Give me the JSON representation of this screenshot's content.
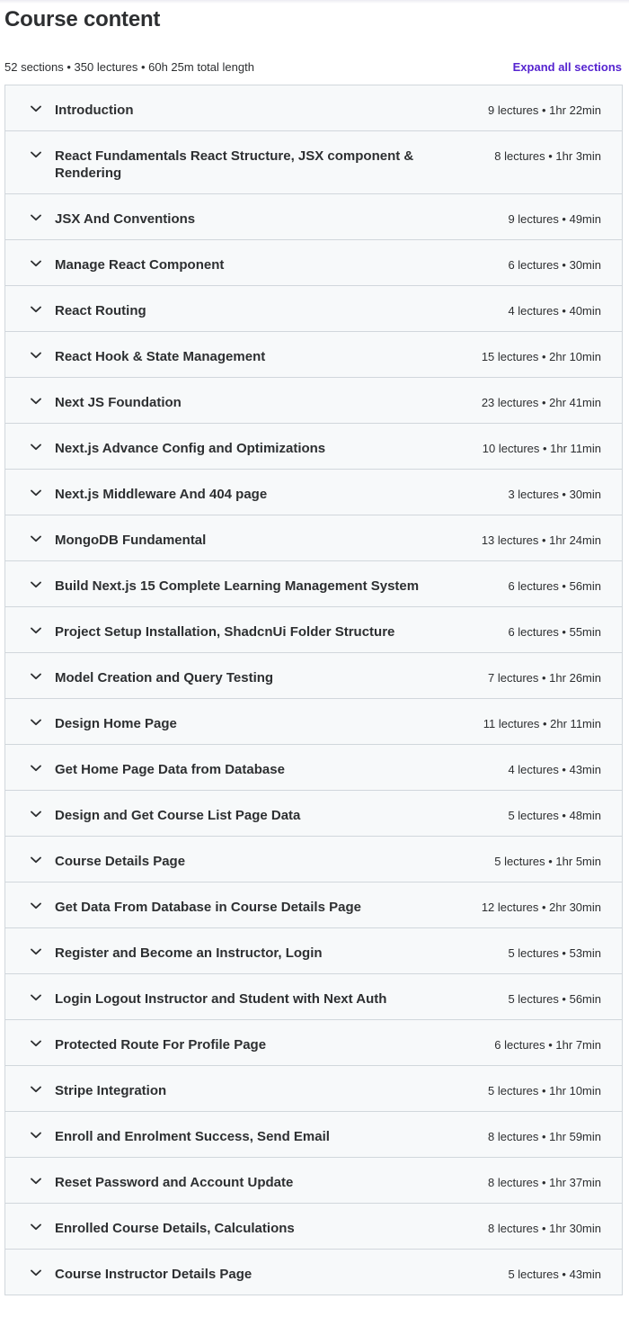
{
  "header": {
    "title": "Course content",
    "summary": "52 sections • 350 lectures • 60h 25m total length",
    "expand_all_label": "Expand all sections"
  },
  "colors": {
    "accent": "#5624d0",
    "section_bg": "#f7f9fa",
    "border": "#d1d7dc",
    "text": "#2d2f31"
  },
  "sections": [
    {
      "title": "Introduction",
      "meta": "9 lectures • 1hr 22min"
    },
    {
      "title": "React Fundamentals React Structure, JSX component & Rendering",
      "meta": "8 lectures • 1hr 3min"
    },
    {
      "title": "JSX And Conventions",
      "meta": "9 lectures • 49min"
    },
    {
      "title": "Manage React Component",
      "meta": "6 lectures • 30min"
    },
    {
      "title": "React Routing",
      "meta": "4 lectures • 40min"
    },
    {
      "title": "React Hook & State Management",
      "meta": "15 lectures • 2hr 10min"
    },
    {
      "title": "Next JS Foundation",
      "meta": "23 lectures • 2hr 41min"
    },
    {
      "title": "Next.js Advance Config and Optimizations",
      "meta": "10 lectures • 1hr 11min"
    },
    {
      "title": "Next.js Middleware And 404 page",
      "meta": "3 lectures • 30min"
    },
    {
      "title": "MongoDB Fundamental",
      "meta": "13 lectures • 1hr 24min"
    },
    {
      "title": "Build Next.js 15 Complete Learning Management System",
      "meta": "6 lectures • 56min"
    },
    {
      "title": "Project Setup Installation, ShadcnUi Folder Structure",
      "meta": "6 lectures • 55min"
    },
    {
      "title": "Model Creation and Query Testing",
      "meta": "7 lectures • 1hr 26min"
    },
    {
      "title": "Design Home Page",
      "meta": "11 lectures • 2hr 11min"
    },
    {
      "title": "Get Home Page Data from Database",
      "meta": "4 lectures • 43min"
    },
    {
      "title": "Design and Get Course List Page Data",
      "meta": "5 lectures • 48min"
    },
    {
      "title": "Course Details Page",
      "meta": "5 lectures • 1hr 5min"
    },
    {
      "title": "Get Data From Database in Course Details Page",
      "meta": "12 lectures • 2hr 30min"
    },
    {
      "title": "Register and Become an Instructor, Login",
      "meta": "5 lectures • 53min"
    },
    {
      "title": "Login Logout Instructor and Student with Next Auth",
      "meta": "5 lectures • 56min"
    },
    {
      "title": "Protected Route For Profile Page",
      "meta": "6 lectures • 1hr 7min"
    },
    {
      "title": "Stripe Integration",
      "meta": "5 lectures • 1hr 10min"
    },
    {
      "title": "Enroll and Enrolment Success, Send Email",
      "meta": "8 lectures • 1hr 59min"
    },
    {
      "title": "Reset Password and Account Update",
      "meta": "8 lectures • 1hr 37min"
    },
    {
      "title": "Enrolled Course Details, Calculations",
      "meta": "8 lectures • 1hr 30min"
    },
    {
      "title": "Course Instructor Details Page",
      "meta": "5 lectures • 43min"
    }
  ]
}
